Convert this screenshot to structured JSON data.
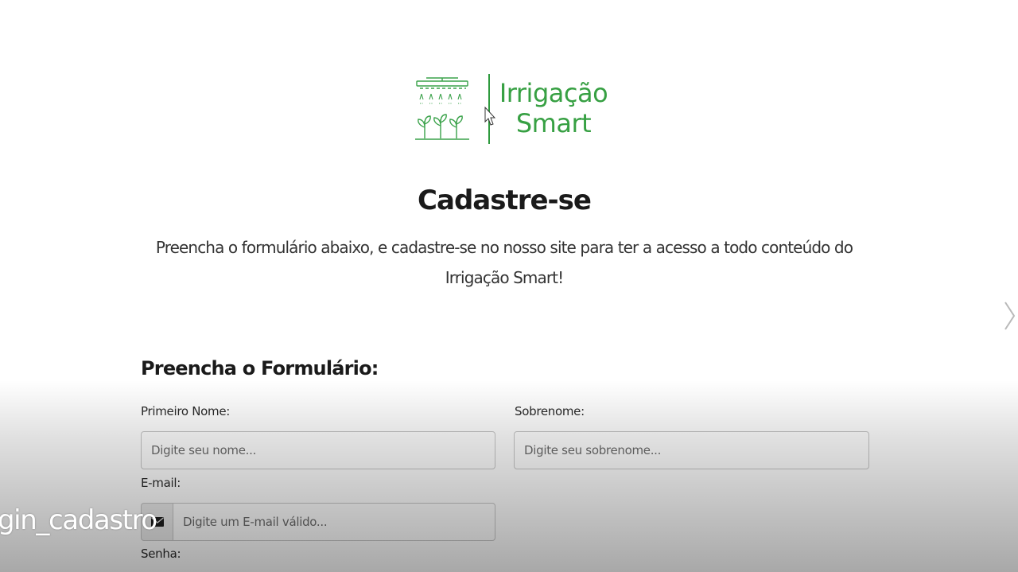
{
  "brand": {
    "line1": "Irrigação",
    "line2": "Smart",
    "logo_icon": "irrigation-sprinkler-plants-icon",
    "color": "#37a043"
  },
  "header": {
    "title": "Cadastre-se",
    "subtitle": "Preencha o formulário abaixo, e cadastre-se no nosso site para ter a acesso a todo conteúdo do Irrigação Smart!"
  },
  "form": {
    "heading": "Preencha o Formulário:",
    "first_name": {
      "label": "Primeiro Nome:",
      "placeholder": "Digite seu nome..."
    },
    "last_name": {
      "label": "Sobrenome:",
      "placeholder": "Digite seu sobrenome..."
    },
    "email": {
      "label": "E-mail:",
      "placeholder": "Digite um E-mail válido...",
      "icon": "envelope-icon"
    },
    "password": {
      "label": "Senha:"
    }
  },
  "overlay": {
    "caption": "gin_cadastro",
    "next_icon": "chevron-right-icon"
  }
}
